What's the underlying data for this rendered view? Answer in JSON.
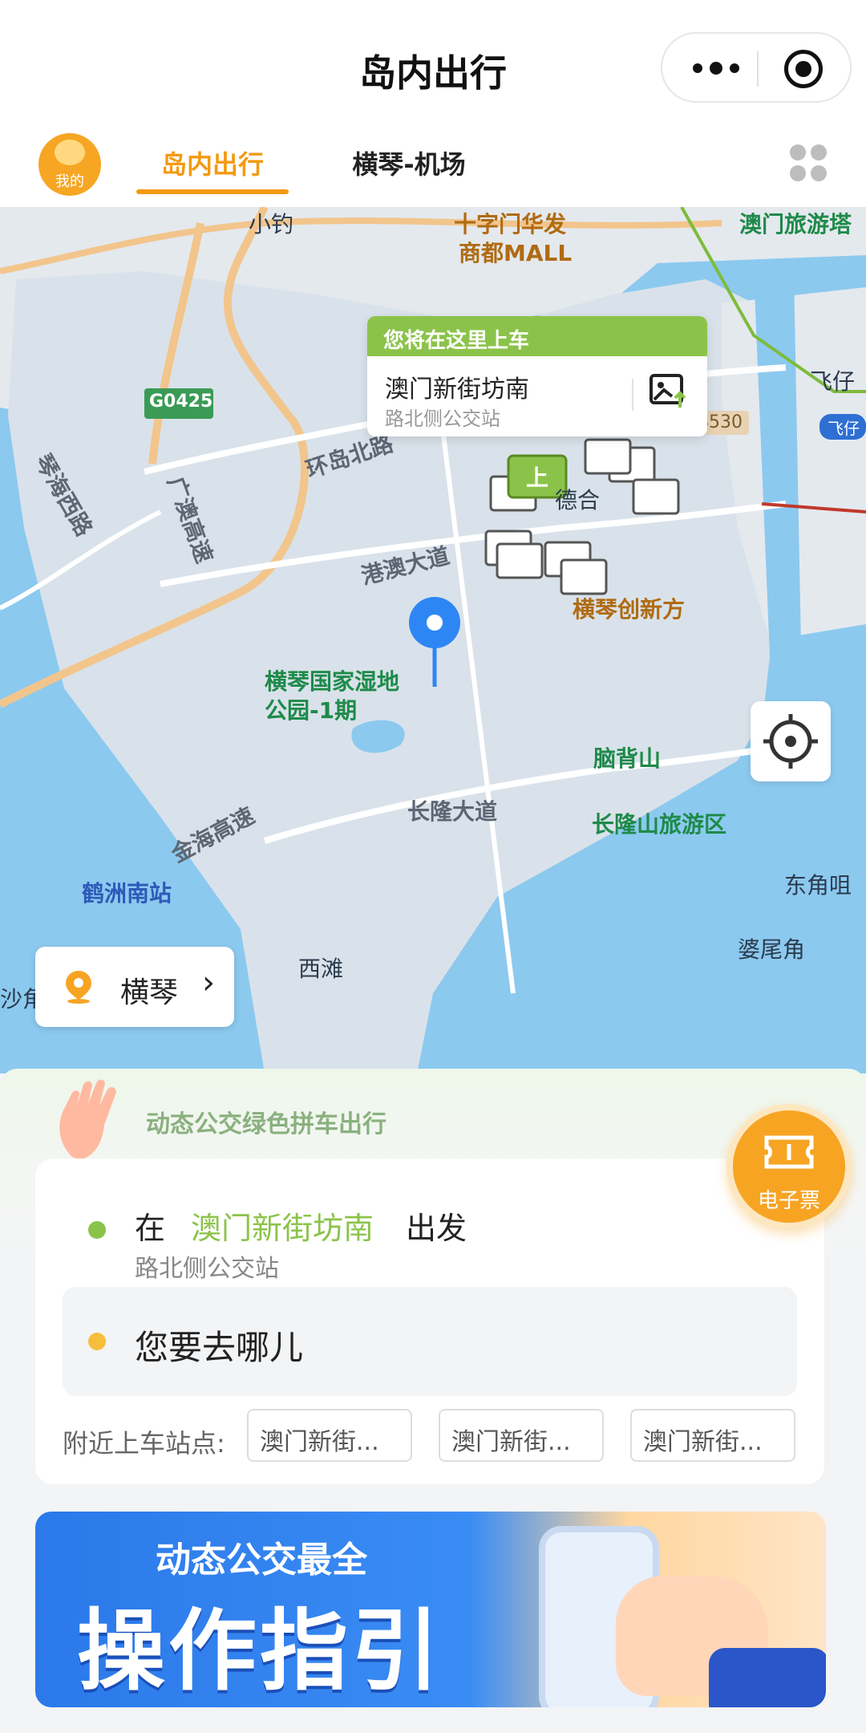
{
  "header": {
    "title": "岛内出行"
  },
  "tabs": {
    "avatar_label": "我的",
    "items": [
      "岛内出行",
      "横琴-机场"
    ],
    "active_index": 0
  },
  "map": {
    "labels": {
      "xiaodiao": "小钓",
      "mall": "十字门华发\n商都MALL",
      "mall_line1": "十字门华发",
      "mall_line2": "商都MALL",
      "macau_tour": "澳门旅游塔",
      "fei": "飞仔",
      "fei_badge": "飞仔",
      "g0425": "G0425",
      "s530": "S530",
      "qinhai": "琴海西路",
      "guangao": "广澳高速",
      "huanbei": "环岛北路",
      "gangao": "港澳大道",
      "chuangxin": "横琴创新方",
      "wetland_l1": "横琴国家湿地",
      "wetland_l2": "公园-1期",
      "naobei": "脑背山",
      "changlong_rd": "长隆大道",
      "changlong_park": "长隆山旅游区",
      "jinhai": "金海高速",
      "hezhou": "鹤洲南站",
      "dongjiao": "东角咀",
      "louwei": "婆尾角",
      "xitan": "西滩",
      "shajiao": "沙角",
      "dehe": "德合",
      "up_marker": "上"
    },
    "pickup_bubble": {
      "header": "您将在这里上车",
      "station": "澳门新街坊南",
      "sub": "路北侧公交站"
    },
    "city_selector": "横琴"
  },
  "panel": {
    "slogan": "动态公交绿色拼车出行",
    "ticket_label": "电子票",
    "from": {
      "prefix": "在",
      "station": "澳门新街坊南",
      "suffix": "出发",
      "sub": "路北侧公交站"
    },
    "destination_placeholder": "您要去哪儿",
    "nearby_label": "附近上车站点:",
    "nearby_stations": [
      "澳门新街...",
      "澳门新街...",
      "澳门新街..."
    ],
    "banner": {
      "subtitle": "动态公交最全",
      "title": "操作指引"
    }
  },
  "colors": {
    "accent_orange": "#f39a11",
    "accent_green": "#8bc34a",
    "map_water": "#8cc9ef",
    "map_land": "#d9e2ea"
  }
}
